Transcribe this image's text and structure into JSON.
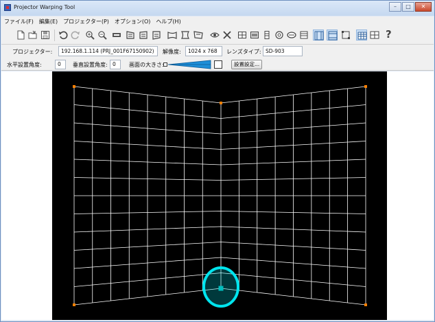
{
  "window": {
    "title": "Projector Warping Tool"
  },
  "menu": {
    "items": [
      "ファイル(F)",
      "編集(E)",
      "プロジェクター(P)",
      "オプション(O)",
      "ヘルプ(H)"
    ]
  },
  "toolbar": {
    "help_glyph": "?"
  },
  "projector": {
    "label": "プロジェクター:",
    "value": "192.168.1.114 (PRJ_001F67150902)",
    "resolution_label": "解像度:",
    "resolution_value": "1024 x 768",
    "lens_label": "レンズタイプ:",
    "lens_value": "SD-903"
  },
  "settings": {
    "h_angle_label": "水平設置角度:",
    "h_angle_value": "0",
    "v_angle_label": "垂直設置角度:",
    "v_angle_value": "0",
    "size_label": "画面の大きさ:",
    "install_button": "設置設定..."
  },
  "colors": {
    "grid_line": "#ffffff",
    "handle": "#ff8000",
    "highlight_ring": "#00e5ee",
    "selected_handle": "#00c0c0",
    "size_slider": "#1f8fd8"
  },
  "grid": {
    "columns": 16,
    "rows": 12
  }
}
